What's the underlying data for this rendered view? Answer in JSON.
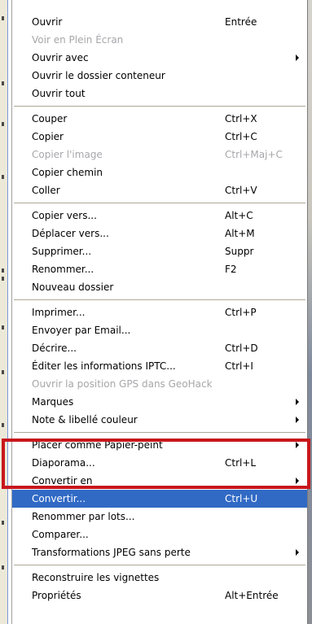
{
  "menu": {
    "groups": [
      [
        {
          "label": "Ouvrir",
          "shortcut": "Entrée",
          "disabled": false,
          "submenu": false
        },
        {
          "label": "Voir en Plein Écran",
          "shortcut": "",
          "disabled": true,
          "submenu": false
        },
        {
          "label": "Ouvrir avec",
          "shortcut": "",
          "disabled": false,
          "submenu": true
        },
        {
          "label": "Ouvrir le dossier conteneur",
          "shortcut": "",
          "disabled": false,
          "submenu": false
        },
        {
          "label": "Ouvrir tout",
          "shortcut": "",
          "disabled": false,
          "submenu": false
        }
      ],
      [
        {
          "label": "Couper",
          "shortcut": "Ctrl+X",
          "disabled": false,
          "submenu": false
        },
        {
          "label": "Copier",
          "shortcut": "Ctrl+C",
          "disabled": false,
          "submenu": false
        },
        {
          "label": "Copier l'image",
          "shortcut": "Ctrl+Maj+C",
          "disabled": true,
          "submenu": false
        },
        {
          "label": "Copier chemin",
          "shortcut": "",
          "disabled": false,
          "submenu": false
        },
        {
          "label": "Coller",
          "shortcut": "Ctrl+V",
          "disabled": false,
          "submenu": false
        }
      ],
      [
        {
          "label": "Copier vers...",
          "shortcut": "Alt+C",
          "disabled": false,
          "submenu": false
        },
        {
          "label": "Déplacer vers...",
          "shortcut": "Alt+M",
          "disabled": false,
          "submenu": false
        },
        {
          "label": "Supprimer...",
          "shortcut": "Suppr",
          "disabled": false,
          "submenu": false
        },
        {
          "label": "Renommer...",
          "shortcut": "F2",
          "disabled": false,
          "submenu": false
        },
        {
          "label": "Nouveau dossier",
          "shortcut": "",
          "disabled": false,
          "submenu": false
        }
      ],
      [
        {
          "label": "Imprimer...",
          "shortcut": "Ctrl+P",
          "disabled": false,
          "submenu": false
        },
        {
          "label": "Envoyer par Email...",
          "shortcut": "",
          "disabled": false,
          "submenu": false
        },
        {
          "label": "Décrire...",
          "shortcut": "Ctrl+D",
          "disabled": false,
          "submenu": false
        },
        {
          "label": "Éditer les informations IPTC...",
          "shortcut": "Ctrl+I",
          "disabled": false,
          "submenu": false
        },
        {
          "label": "Ouvrir la position GPS dans GeoHack",
          "shortcut": "",
          "disabled": true,
          "submenu": false
        },
        {
          "label": "Marques",
          "shortcut": "",
          "disabled": false,
          "submenu": true
        },
        {
          "label": "Note & libellé couleur",
          "shortcut": "",
          "disabled": false,
          "submenu": true
        }
      ],
      [
        {
          "label": "Placer comme Papier-peint",
          "shortcut": "",
          "disabled": false,
          "submenu": true
        },
        {
          "label": "Diaporama...",
          "shortcut": "Ctrl+L",
          "disabled": false,
          "submenu": false
        },
        {
          "label": "Convertir en",
          "shortcut": "",
          "disabled": false,
          "submenu": true
        },
        {
          "label": "Convertir...",
          "shortcut": "Ctrl+U",
          "disabled": false,
          "submenu": false,
          "selected": true
        },
        {
          "label": "Renommer par lots...",
          "shortcut": "",
          "disabled": false,
          "submenu": false
        },
        {
          "label": "Comparer...",
          "shortcut": "",
          "disabled": false,
          "submenu": false
        },
        {
          "label": "Transformations JPEG sans perte",
          "shortcut": "",
          "disabled": false,
          "submenu": true
        }
      ],
      [
        {
          "label": "Reconstruire les vignettes",
          "shortcut": "",
          "disabled": false,
          "submenu": false
        },
        {
          "label": "Propriétés",
          "shortcut": "Alt+Entrée",
          "disabled": false,
          "submenu": false
        }
      ]
    ]
  },
  "colors": {
    "selected_bg": "#316ac5",
    "disabled_text": "#a7a6aa",
    "annotation_box": "#c8171c"
  }
}
